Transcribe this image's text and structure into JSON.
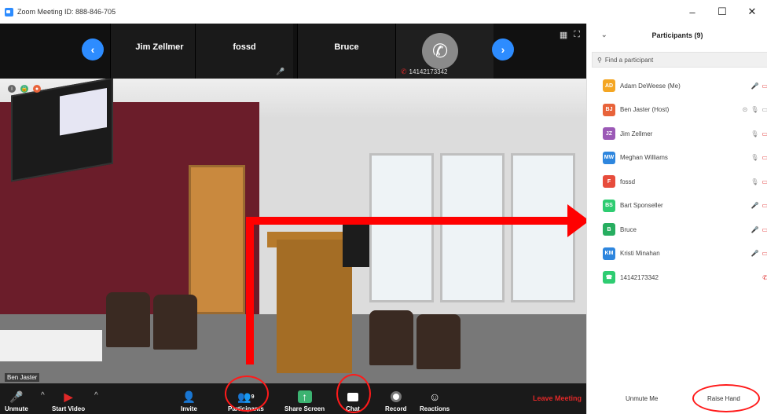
{
  "window": {
    "title": "Zoom Meeting ID: 888-846-705",
    "controls": {
      "minimize": "–",
      "maximize": "☐",
      "close": "✕"
    }
  },
  "strip": {
    "nav_prev": "‹",
    "nav_next": "›",
    "tiles": [
      {
        "name": "Jim Zellmer"
      },
      {
        "name": "fossd"
      },
      {
        "name": "Bruce"
      }
    ],
    "phone_label": "14142173342",
    "view_grid": "▦",
    "view_fullscreen": "⛶"
  },
  "video": {
    "speaker_label": "Ben Jaster"
  },
  "toolbar": {
    "unmute": "Unmute",
    "start_video": "Start Video",
    "invite": "Invite",
    "participants": "Participants",
    "participants_count": "9",
    "share_screen": "Share Screen",
    "chat": "Chat",
    "record": "Record",
    "reactions": "Reactions",
    "leave": "Leave Meeting"
  },
  "panel": {
    "title": "Participants (9)",
    "search_placeholder": "Find a participant",
    "participants": [
      {
        "initials": "AD",
        "name": "Adam DeWeese (Me)",
        "color": "#f4a623"
      },
      {
        "initials": "BJ",
        "name": "Ben Jaster (Host)",
        "color": "#e8633a"
      },
      {
        "initials": "JZ",
        "name": "Jim Zellmer",
        "color": "#9b59b6"
      },
      {
        "initials": "MW",
        "name": "Meghan Williams",
        "color": "#2e86de"
      },
      {
        "initials": "F",
        "name": "fossd",
        "color": "#e74c3c"
      },
      {
        "initials": "BS",
        "name": "Bart Sponseller",
        "color": "#2ecc71"
      },
      {
        "initials": "B",
        "name": "Bruce",
        "color": "#27ae60"
      },
      {
        "initials": "KM",
        "name": "Kristi Minahan",
        "color": "#2e86de"
      },
      {
        "initials": "☎",
        "name": "14142173342",
        "color": "#2ecc71"
      }
    ],
    "unmute_me": "Unmute Me",
    "raise_hand": "Raise Hand"
  },
  "colors": {
    "accent": "#2d8cff",
    "annotation_red": "#ff0000",
    "leave_red": "#e02828"
  }
}
